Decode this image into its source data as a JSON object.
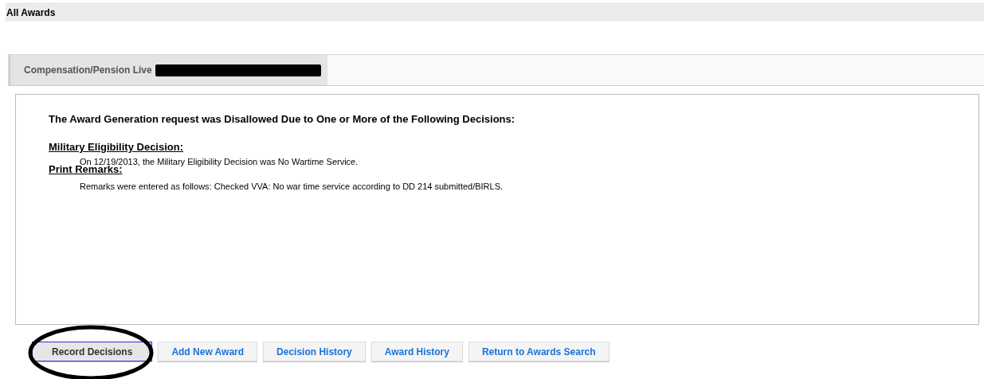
{
  "header": {
    "title": "All Awards"
  },
  "tabs": [
    {
      "label": "Compensation/Pension Live",
      "selected": true,
      "redacted": true
    }
  ],
  "message": {
    "heading": "The Award Generation request was Disallowed Due to One or More of the Following Decisions:",
    "sections": [
      {
        "title": "Military Eligibility Decision:",
        "text": "On 12/19/2013, the Military Eligibility Decision was No Wartime Service."
      },
      {
        "title": "Print Remarks:",
        "text": "Remarks were entered as follows: Checked VVA: No war time service according to DD 214 submitted/BIRLS."
      }
    ]
  },
  "buttons": [
    {
      "label": "Record Decisions",
      "selected": true,
      "circled": true
    },
    {
      "label": "Add New Award",
      "selected": false,
      "circled": false
    },
    {
      "label": "Decision History",
      "selected": false,
      "circled": false
    },
    {
      "label": "Award History",
      "selected": false,
      "circled": false
    },
    {
      "label": "Return to Awards Search",
      "selected": false,
      "circled": false
    }
  ]
}
